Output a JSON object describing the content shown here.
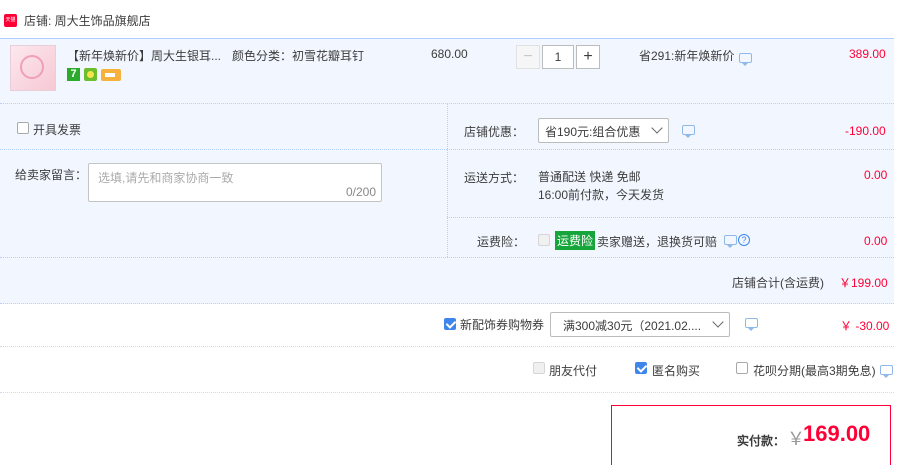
{
  "shop": {
    "badge": "天猫",
    "name": "店铺: 周大生饰品旗舰店"
  },
  "item": {
    "title": "【新年焕新价】周大生银耳...",
    "sku": "颜色分类：初雪花瓣耳钉",
    "price": "680.00",
    "quantity": "1",
    "minus": "−",
    "plus": "+",
    "promo": "省291:新年焕新价",
    "subtotal": "389.00",
    "badge_seven": "7"
  },
  "invoice": {
    "label": "开具发票"
  },
  "message": {
    "label": "给卖家留言：",
    "placeholder": "选填,请先和商家协商一致",
    "counter": "0/200"
  },
  "discount": {
    "label": "店铺优惠：",
    "selected": "省190元:组合优惠",
    "amount": "-190.00"
  },
  "shipping": {
    "label": "运送方式：",
    "method": "普通配送 快递 免邮",
    "note": "16:00前付款，今天发货",
    "amount": "0.00"
  },
  "insurance": {
    "label": "运费险：",
    "tag": "运费险",
    "text": "卖家赠送，退换货可赔",
    "amount": "0.00"
  },
  "shop_total": {
    "label": "店铺合计(含运费)",
    "amount": "￥199.00"
  },
  "coupon": {
    "label": "新配饰券购物券",
    "selected": "满300减30元（2021.02....",
    "amount": "￥ -30.00"
  },
  "options": {
    "friend_pay": "朋友代付",
    "anonymous": "匿名购买",
    "huabei": "花呗分期(最高3期免息)"
  },
  "payment": {
    "label": "实付款：",
    "currency": "￥",
    "amount": "169.00"
  },
  "colors": {
    "accent_red": "#ff0036",
    "panel_blue": "#f2f7ff",
    "divider_blue": "#b2d1ff",
    "checkbox_blue": "#3f86ec"
  }
}
